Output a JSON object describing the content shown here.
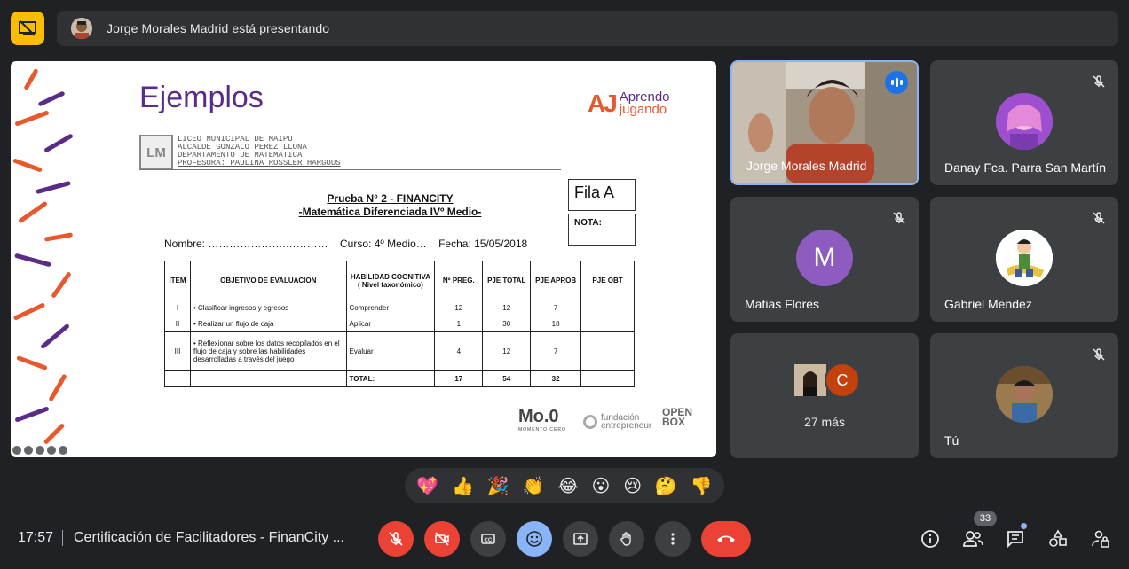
{
  "presenter_bar": {
    "text": "Jorge Morales Madrid está presentando"
  },
  "slide": {
    "title": "Ejemplos",
    "brand": {
      "aj": "AJ",
      "line1": "Aprendo",
      "line2": "jugando"
    },
    "school_logo": "LM",
    "school_lines": [
      "LICEO    MUNICIPAL  DE    MAIPU",
      "ALCALDE GONZALO PEREZ LLONA",
      "DEPARTAMENTO DE MATEMATICA",
      "PROFESORA: PAULINA ROSSLER HARGOUS"
    ],
    "test_title_1": "Prueba N° 2 - FINANCITY",
    "test_title_2": "-Matemática Diferenciada IVº Medio-",
    "fila": "Fila A",
    "nota": "NOTA:",
    "nombre_line": "Nombre: ………………….…………    Curso: 4º Medio…    Fecha: 15/05/2018",
    "table": {
      "headers": [
        "ITEM",
        "OBJETIVO DE EVALUACION",
        "HABILIDAD COGNITIVA ( Nivel taxonómico)",
        "Nº PREG.",
        "PJE TOTAL",
        "PJE APROB",
        "PJE OBT"
      ],
      "rows": [
        {
          "item": "I",
          "objetivo": "• Clasificar ingresos y egresos",
          "habilidad": "Comprender",
          "preg": "12",
          "total": "12",
          "aprob": "7",
          "obt": ""
        },
        {
          "item": "II",
          "objetivo": "• Realizar un flujo de caja",
          "habilidad": "Aplicar",
          "preg": "1",
          "total": "30",
          "aprob": "18",
          "obt": ""
        },
        {
          "item": "III",
          "objetivo": "• Reflexionar sobre los datos recopilados en el flujo de caja y sobre las habilidades desarrolladas a través del juego",
          "habilidad": "Evaluar",
          "preg": "4",
          "total": "12",
          "aprob": "7",
          "obt": ""
        }
      ],
      "total_row": {
        "label": "TOTAL:",
        "preg": "17",
        "total": "54",
        "aprob": "32"
      }
    },
    "sponsors": {
      "mo0": "Mo.0",
      "mo0_sub": "MOMENTO CERO",
      "fundacion_1": "fundación",
      "fundacion_2": "entrepreneur",
      "openbox_1": "OPEN",
      "openbox_2": "BOX"
    }
  },
  "participants": [
    {
      "name": "Jorge Morales Madrid",
      "state": "speaking"
    },
    {
      "name": "Danay Fca. Parra San Martín",
      "state": "muted"
    },
    {
      "name": "Matias Flores",
      "initial": "M",
      "state": "muted"
    },
    {
      "name": "Gabriel Mendez",
      "state": "muted"
    },
    {
      "more_initial": "C",
      "more_label": "27 más"
    },
    {
      "name": "Tú",
      "state": "muted"
    }
  ],
  "reactions": [
    "💖",
    "👍",
    "🎉",
    "👏",
    "😂",
    "😮",
    "😢",
    "🤔",
    "👎"
  ],
  "bottom_bar": {
    "time": "17:57",
    "meeting_title": "Certificación de Facilitadores - FinanCity ...",
    "people_count": "33"
  },
  "colors": {
    "accent_blue": "#8ab4f8",
    "danger_red": "#ea4335",
    "presenting_yellow": "#fbbc04",
    "slide_purple": "#5b2c86",
    "slide_orange": "#e8582c"
  }
}
